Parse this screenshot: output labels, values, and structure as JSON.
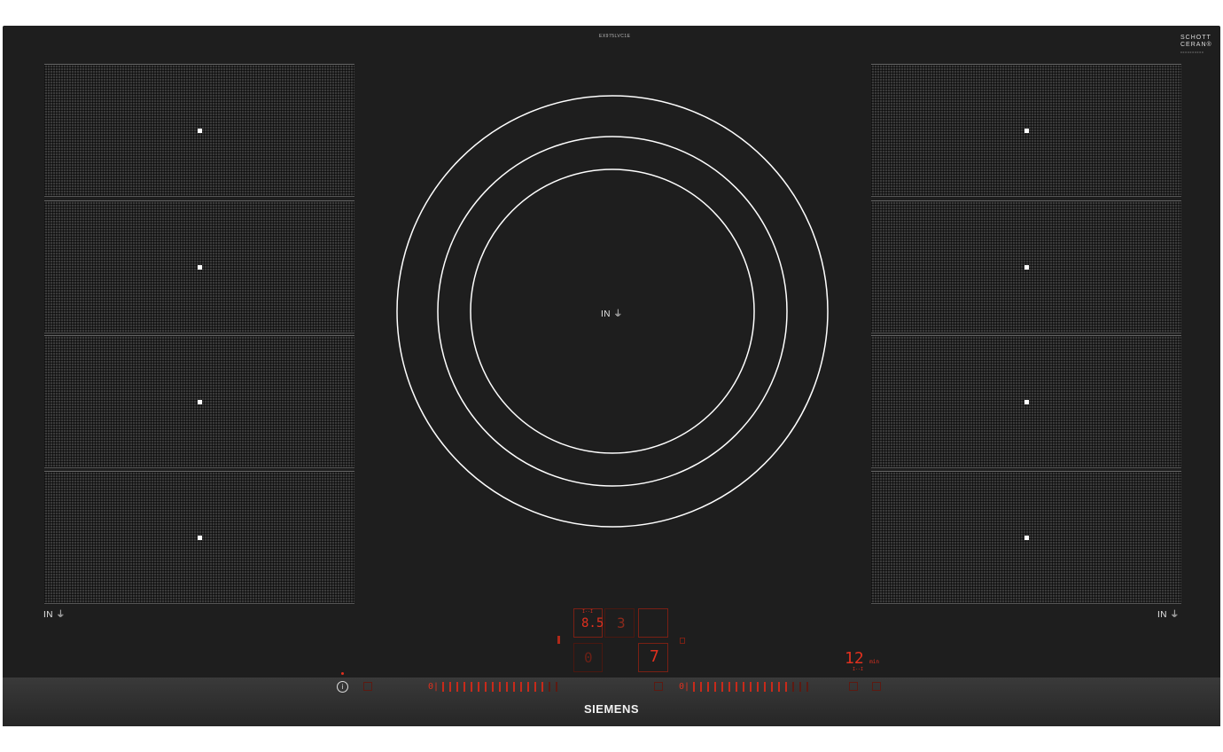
{
  "model_code": "EX975LVC1E",
  "schott_logo": [
    "SCHOTT",
    "CERAN®"
  ],
  "schott_code": "0000000000",
  "zone_label": "IN",
  "zone_symbol": "⏚",
  "brand": "SIEMENS",
  "left_display": {
    "timer_symbol": "I--I",
    "power_value": "8.5",
    "level_value": "3",
    "lower_value": "0"
  },
  "right_display": {
    "level_value": "7"
  },
  "timer_display": {
    "value": "12",
    "unit": "min",
    "symbol": "I--I"
  },
  "slider_left_start": "0|",
  "slider_right_start": "0|",
  "colors": {
    "glass": "#1e1e1e",
    "display_red": "#e0301e",
    "zone_line": "#ffffff"
  },
  "icons": [
    "info-icon",
    "lock-icon",
    "timer-icon"
  ]
}
